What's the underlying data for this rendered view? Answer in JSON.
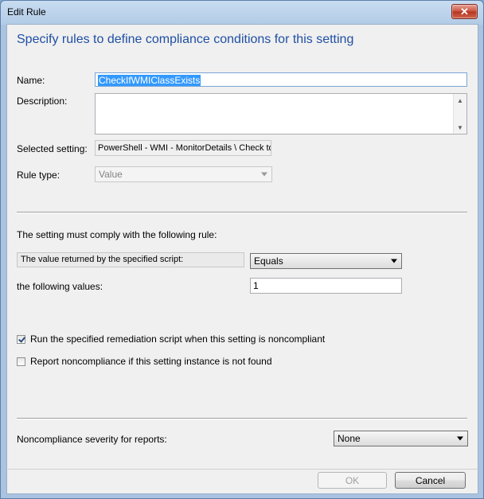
{
  "window": {
    "title": "Edit Rule",
    "close_glyph": "✕"
  },
  "heading": "Specify rules to define compliance conditions for this setting",
  "form": {
    "name_label": "Name:",
    "name_value": "CheckIfWMIClassExists",
    "description_label": "Description:",
    "description_value": "",
    "selected_setting_label": "Selected setting:",
    "selected_setting_value": "PowerShell - WMI - MonitorDetails \\ Check to",
    "rule_type_label": "Rule type:",
    "rule_type_value": "Value"
  },
  "rule": {
    "intro": "The setting must comply with the following rule:",
    "value_returned_label": "The value returned by the specified script:",
    "operator_value": "Equals",
    "following_values_label": "the following values:",
    "following_values_value": "1"
  },
  "options": {
    "remediation_label": "Run the specified remediation script when this setting is noncompliant",
    "remediation_checked": true,
    "report_label": "Report noncompliance if this setting instance is not found",
    "report_checked": false
  },
  "severity": {
    "label": "Noncompliance severity for reports:",
    "value": "None"
  },
  "buttons": {
    "ok": "OK",
    "cancel": "Cancel"
  }
}
